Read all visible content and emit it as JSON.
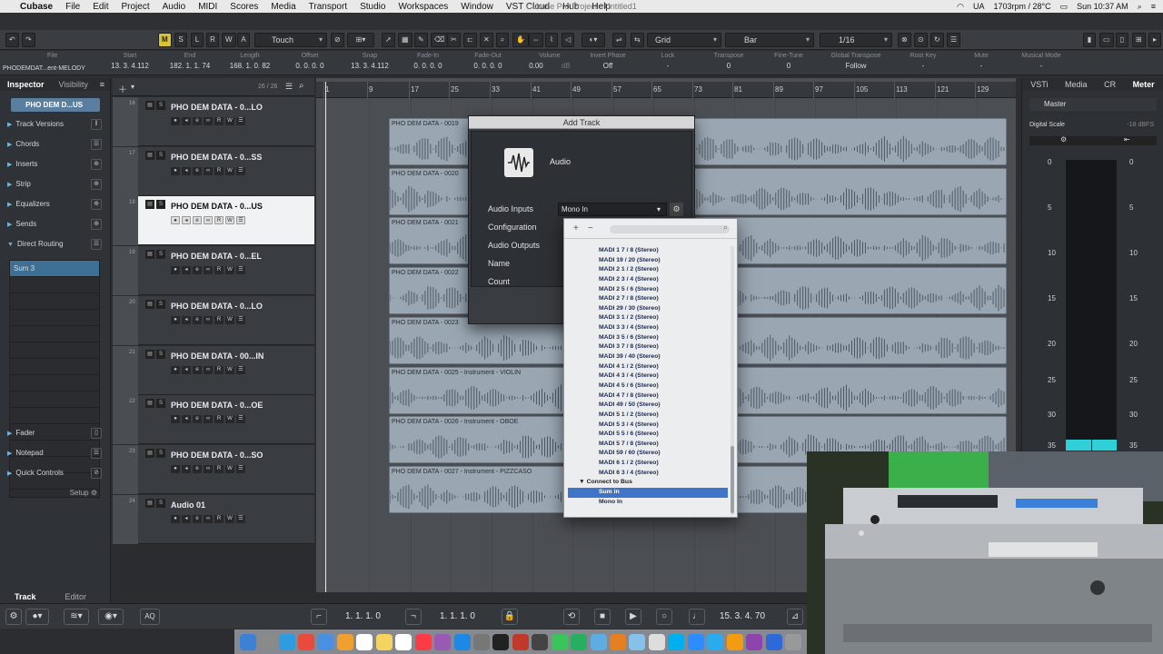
{
  "menubar": {
    "app": "Cubase",
    "items": [
      "File",
      "Edit",
      "Project",
      "Audio",
      "MIDI",
      "Scores",
      "Media",
      "Transport",
      "Studio",
      "Workspaces",
      "Window",
      "VST Cloud",
      "Hub",
      "Help"
    ],
    "doc_title": "Cubase Pro Project - Untitled1",
    "status_lang": "UA",
    "status_temp": "1703rpm / 28°C",
    "clock": "Sun 10:37 AM"
  },
  "toolbar": {
    "mode_m": "M",
    "mode_s": "S",
    "mode_l": "L",
    "mode_r": "R",
    "mode_w": "W",
    "mode_a": "A",
    "automation_mode": "Touch",
    "snap_type": "Grid",
    "grid_type": "Bar",
    "quantize": "1/16"
  },
  "infoline": {
    "track_name": "PHODEMDAT...ent-MELODY",
    "columns": [
      {
        "label": "File",
        "value": ""
      },
      {
        "label": "Start",
        "value": "13. 3. 4.112"
      },
      {
        "label": "End",
        "value": "182. 1. 1. 74"
      },
      {
        "label": "Length",
        "value": "168. 1. 0. 82"
      },
      {
        "label": "Offset",
        "value": "0. 0. 0. 0"
      },
      {
        "label": "Snap",
        "value": "13. 3. 4.112"
      },
      {
        "label": "Fade-In",
        "value": "0. 0. 0. 0"
      },
      {
        "label": "Fade-Out",
        "value": "0. 0. 0. 0"
      },
      {
        "label": "Volume",
        "value": "0.00"
      },
      {
        "label": "Invert Phase",
        "value": "Off"
      },
      {
        "label": "Lock",
        "value": "-"
      },
      {
        "label": "Transpose",
        "value": "0"
      },
      {
        "label": "Fine-Tune",
        "value": "0"
      },
      {
        "label": "Global Transpose",
        "value": "Follow"
      },
      {
        "label": "Root Key",
        "value": "-"
      },
      {
        "label": "Mute",
        "value": "-"
      },
      {
        "label": "Musical Mode",
        "value": "-"
      }
    ],
    "volume_unit": "dB"
  },
  "inspector": {
    "tab_inspector": "Inspector",
    "tab_visibility": "Visibility",
    "track_name": "PHO DEM D...US",
    "sections": [
      "Track Versions",
      "Chords",
      "Inserts",
      "Strip",
      "Equalizers",
      "Sends",
      "Direct Routing"
    ],
    "direct_routing_slots": [
      "Sum 3",
      "",
      "",
      "",
      "",
      "",
      "",
      "",
      "",
      "",
      "",
      "",
      "",
      ""
    ],
    "lower_sections": [
      "Fader",
      "Notepad",
      "Quick Controls"
    ],
    "setup": "Setup",
    "bottom_tab_track": "Track",
    "bottom_tab_editor": "Editor"
  },
  "tracklist": {
    "counter": "26 / 26",
    "tracks": [
      {
        "num": "16",
        "name": "PHO DEM  DATA - 0...LO"
      },
      {
        "num": "17",
        "name": "PHO DEM  DATA - 0...SS"
      },
      {
        "num": "18",
        "name": "PHO DEM  DATA - 0...US"
      },
      {
        "num": "19",
        "name": "PHO DEM  DATA - 0...EL"
      },
      {
        "num": "20",
        "name": "PHO DEM  DATA - 0...LO"
      },
      {
        "num": "21",
        "name": "PHO DEM  DATA - 00...IN"
      },
      {
        "num": "22",
        "name": "PHO DEM  DATA - 0...OE"
      },
      {
        "num": "23",
        "name": "PHO DEM  DATA - 0...SO"
      },
      {
        "num": "24",
        "name": "Audio 01"
      }
    ]
  },
  "project": {
    "ruler": [
      "1",
      "9",
      "17",
      "25",
      "33",
      "41",
      "49",
      "57",
      "65",
      "73",
      "81",
      "89",
      "97",
      "105",
      "113",
      "121",
      "129"
    ],
    "events": [
      "PHO DEM  DATA - 0019",
      "PHO DEM  DATA - 0020",
      "PHO DEM  DATA - 0021",
      "PHO DEM  DATA - 0022",
      "PHO DEM  DATA - 0023",
      "PHO DEM  DATA - 0025 - Instrument - VIOLIN",
      "PHO DEM  DATA - 0026 - Instrument - OBOE",
      "PHO DEM  DATA - 0027 - Instrument - PIZZCASO"
    ]
  },
  "addtrack": {
    "title": "Add Track",
    "type": "Audio",
    "labels": [
      "Audio Inputs",
      "Configuration",
      "Audio Outputs",
      "Name",
      "Count"
    ],
    "audio_inputs_value": "Mono In"
  },
  "buspopup": {
    "items": [
      "MADI 1 7 / 8 (Stereo)",
      "MADI 19 / 20 (Stereo)",
      "MADI 2 1 / 2 (Stereo)",
      "MADI 2 3 / 4 (Stereo)",
      "MADI 2 5 / 6 (Stereo)",
      "MADI 2 7 / 8 (Stereo)",
      "MADI 29 / 30 (Stereo)",
      "MADI 3 1 / 2 (Stereo)",
      "MADI 3 3 / 4 (Stereo)",
      "MADI 3 5 / 6 (Stereo)",
      "MADI 3 7 / 8 (Stereo)",
      "MADI 39 / 40 (Stereo)",
      "MADI 4 1 / 2 (Stereo)",
      "MADI 4 3 / 4 (Stereo)",
      "MADI 4 5 / 6 (Stereo)",
      "MADI 4 7 / 8 (Stereo)",
      "MADI 49 / 50 (Stereo)",
      "MADI 5 1 / 2 (Stereo)",
      "MADI 5 3 / 4 (Stereo)",
      "MADI 5 5 / 6 (Stereo)",
      "MADI 5 7 / 8 (Stereo)",
      "MADI 59 / 60 (Stereo)",
      "MADI 6 1 / 2 (Stereo)",
      "MADI 6 3 / 4 (Stereo)"
    ],
    "folder": "Connect to Bus",
    "bus_items": [
      "Sum in",
      "Mono In"
    ],
    "add_symbol": "+",
    "remove_symbol": "−"
  },
  "rightzone": {
    "tabs": [
      "VSTi",
      "Media",
      "CR",
      "Meter"
    ],
    "master": "Master",
    "scale_label": "Digital Scale",
    "scale_value": "-18 dBFS",
    "marks": [
      "0",
      "5",
      "10",
      "15",
      "20",
      "25",
      "30",
      "35"
    ]
  },
  "transport": {
    "left_locator": "1. 1. 1.   0",
    "right_locator": "1. 1. 1.   0",
    "position": "15. 3. 4. 70",
    "aq": "AQ"
  },
  "colors": {
    "accent": "#3f74c9",
    "event": "#9aa7b3",
    "meter_peak": "#2fd0d8"
  }
}
